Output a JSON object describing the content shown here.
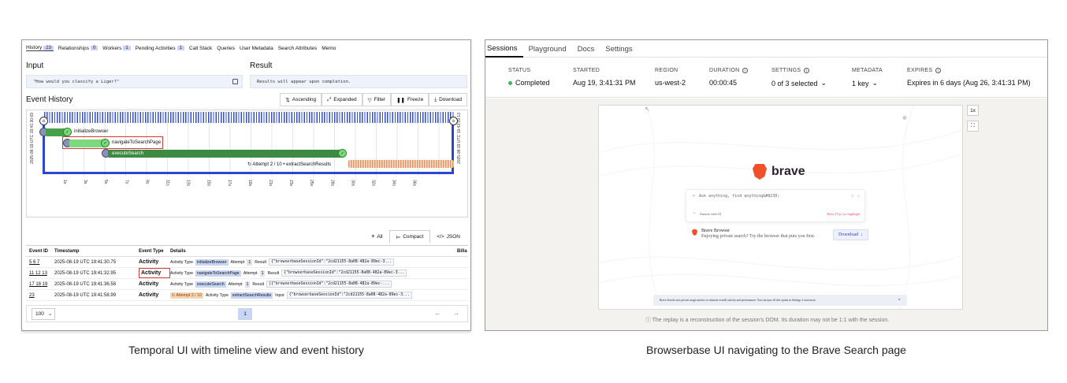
{
  "temporal": {
    "tabs": [
      {
        "label": "History",
        "badge": "23"
      },
      {
        "label": "Relationships",
        "badge": "0"
      },
      {
        "label": "Workers",
        "badge": "1"
      },
      {
        "label": "Pending Activities",
        "badge": "1"
      },
      {
        "label": "Call Stack",
        "badge": ""
      },
      {
        "label": "Queries",
        "badge": ""
      },
      {
        "label": "User Metadata",
        "badge": ""
      },
      {
        "label": "Search Attributes",
        "badge": ""
      },
      {
        "label": "Memo",
        "badge": ""
      }
    ],
    "input_title": "Input",
    "input_value": "\"How would you classify a Liger?\"",
    "result_title": "Result",
    "result_value": "Results will appear upon completion.",
    "event_history_title": "Event History",
    "controls": {
      "ascending": "Ascending",
      "expanded": "Expanded",
      "filter": "Filter",
      "freeze": "Freeze",
      "download": "Download"
    },
    "timeline": {
      "start_label": "2025-08-19 UTC 19:41:30.69",
      "end_label": "2025-08-19 UTC 19:42:09.13",
      "bars": [
        "initializeBrowser",
        "navigateToSearchPage",
        "executeSearch",
        "Attempt 2 / 10 • extractSearchResults"
      ],
      "axis_ticks": [
        "1s",
        "3s",
        "5s",
        "7s",
        "9s",
        "11s",
        "13s",
        "15s",
        "17s",
        "19s",
        "21s",
        "23s",
        "25s",
        "28s",
        "30s",
        "32s",
        "34s",
        "36s"
      ]
    },
    "views": {
      "all": "All",
      "compact": "Compact",
      "json": "JSON"
    },
    "table": {
      "headers": [
        "Event ID",
        "Timestamp",
        "Event Type",
        "Details",
        "Billa"
      ],
      "rows": [
        {
          "ids": "5 6 7",
          "ts": "2025-08-19 UTC 19:41:30.75",
          "type": "Activity",
          "attempt": "",
          "activity": "initializeBrowser",
          "att_num": "1",
          "out_label": "Result",
          "out": "{\"browserbaseSessionId\":\"2cd21155-8a08-482a-89ec-3..."
        },
        {
          "ids": "11 12 13",
          "ts": "2025-08-19 UTC 19:41:32.95",
          "type": "Activity",
          "attempt": "",
          "activity": "navigateToSearchPage",
          "att_num": "1",
          "out_label": "Result",
          "out": "{\"browserbaseSessionId\":\"2cd21155-8a08-482a-89ec-3..."
        },
        {
          "ids": "17 18 19",
          "ts": "2025-08-19 UTC 19:41:36.58",
          "type": "Activity",
          "attempt": "",
          "activity": "executeSearch",
          "att_num": "1",
          "out_label": "Result",
          "out": "[{\"browserbaseSessionId\":\"2cd21155-8a08-482a-89ec-..."
        },
        {
          "ids": "23",
          "ts": "2025-08-19 UTC 19:41:58.99",
          "type": "Activity",
          "attempt": "Attempt 2 / 10",
          "activity": "extractSearchResults",
          "att_num": "",
          "out_label": "Input",
          "out": "{\"browserbaseSessionId\":\"2cd21155-8a08-482a-89ec-3..."
        }
      ],
      "labels": {
        "activity_type": "Activity Type",
        "attempt": "Attempt"
      }
    },
    "pager": {
      "page_size": "100",
      "page": "1"
    }
  },
  "browserbase": {
    "tabs": [
      "Sessions",
      "Playground",
      "Docs",
      "Settings"
    ],
    "meta": {
      "status_head": "STATUS",
      "status_val": "Completed",
      "started_head": "STARTED",
      "started_val": "Aug 19, 3:41:31 PM",
      "region_head": "REGION",
      "region_val": "us-west-2",
      "duration_head": "DURATION",
      "duration_val": "00:00:45",
      "settings_head": "SETTINGS",
      "settings_val": "0 of 3 selected",
      "metadata_head": "METADATA",
      "metadata_val": "1 key",
      "expires_head": "EXPIRES",
      "expires_val": "Expires in 6 days (Aug 26, 3:41:31 PM)"
    },
    "zoom": "1x",
    "brave": {
      "word": "brave",
      "search_placeholder": "Ask anything, find anything&#8230;",
      "answer_ai": "Answer with AI",
      "hint": "Press [ Up ] to highlight",
      "sugg_title": "Brave Browser",
      "sugg_sub": "Enjoying private search? Try the browser that puts you first.",
      "download": "Download",
      "cookie": "Brave Search uses private usage metrics to estimate overall activity and performance. You can turn off this option in Settings. Learn more."
    },
    "footer": "The replay is a reconstruction of the session's DOM. Its duration may not be 1:1 with the session."
  },
  "captions": {
    "left": "Temporal UI with timeline view and event history",
    "right": "Browserbase UI navigating to the Brave Search page"
  },
  "colors": {
    "temporal_blue": "#2d45d0",
    "bar_green": "#3d8a42",
    "red_highlight": "#d63a3a",
    "status_green": "#3cb85a",
    "brave_orange": "#f0502c"
  }
}
